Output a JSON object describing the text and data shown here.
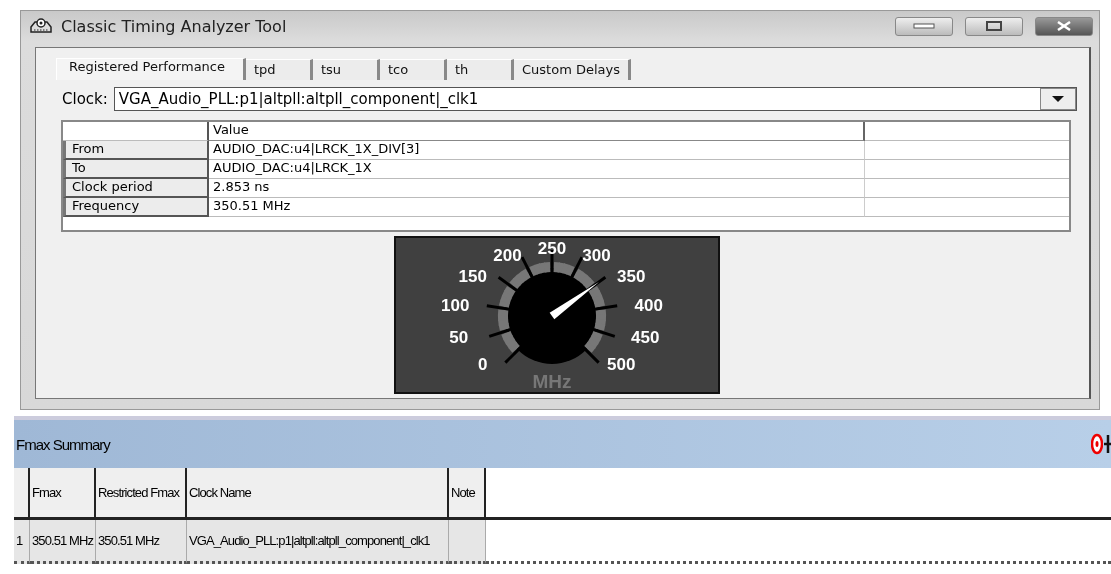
{
  "window": {
    "title": "Classic Timing Analyzer Tool"
  },
  "tabs": [
    {
      "label": "Registered Performance",
      "selected": true
    },
    {
      "label": "tpd",
      "selected": false
    },
    {
      "label": "tsu",
      "selected": false
    },
    {
      "label": "tco",
      "selected": false
    },
    {
      "label": "th",
      "selected": false
    },
    {
      "label": "Custom Delays",
      "selected": false
    }
  ],
  "clock": {
    "label": "Clock:",
    "value": "VGA_Audio_PLL:p1|altpll:altpll_component|_clk1"
  },
  "result_table": {
    "columns": [
      "Value"
    ],
    "rows": [
      {
        "label": "From",
        "value": "AUDIO_DAC:u4|LRCK_1X_DIV[3]"
      },
      {
        "label": "To",
        "value": "AUDIO_DAC:u4|LRCK_1X"
      },
      {
        "label": "Clock period",
        "value": "2.853 ns"
      },
      {
        "label": "Frequency",
        "value": "350.51 MHz"
      }
    ]
  },
  "gauge": {
    "ticks": [
      "0",
      "50",
      "100",
      "150",
      "200",
      "250",
      "300",
      "350",
      "400",
      "450",
      "500"
    ],
    "unit": "MHz"
  },
  "fmax_summary": {
    "title": "Fmax Summary",
    "columns": [
      "Fmax",
      "Restricted Fmax",
      "Clock Name",
      "Note"
    ],
    "rows": [
      {
        "number": "1",
        "cells": [
          "350.51 MHz",
          "350.51 MHz",
          "VGA_Audio_PLL:p1|altpll:altpll_component|_clk1"
        ]
      }
    ]
  }
}
